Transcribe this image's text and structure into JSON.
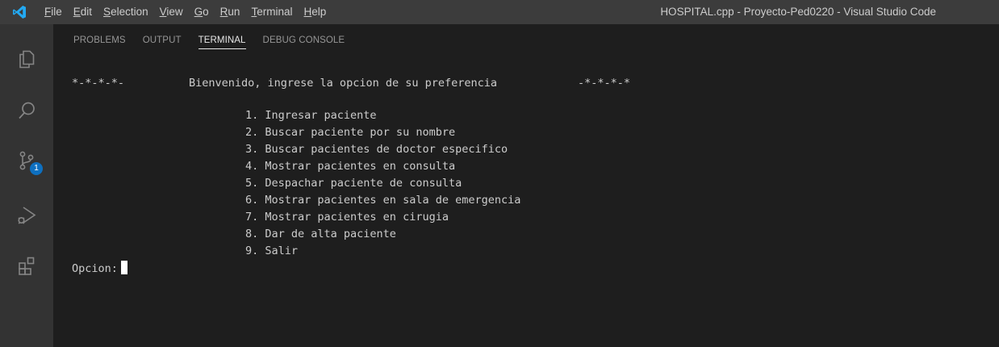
{
  "titlebar": {
    "menu": [
      {
        "mnemonic": "F",
        "rest": "ile"
      },
      {
        "mnemonic": "E",
        "rest": "dit"
      },
      {
        "mnemonic": "S",
        "rest": "election"
      },
      {
        "mnemonic": "V",
        "rest": "iew"
      },
      {
        "mnemonic": "G",
        "rest": "o"
      },
      {
        "mnemonic": "R",
        "rest": "un"
      },
      {
        "mnemonic": "T",
        "rest": "erminal"
      },
      {
        "mnemonic": "H",
        "rest": "elp"
      }
    ],
    "window_title": "HOSPITAL.cpp - Proyecto-Ped0220 - Visual Studio Code"
  },
  "activity_bar": {
    "icons": [
      "explorer-icon",
      "search-icon",
      "source-control-icon",
      "run-debug-icon",
      "extensions-icon"
    ],
    "source_control_badge": "1"
  },
  "panel": {
    "tabs": [
      "PROBLEMS",
      "OUTPUT",
      "TERMINAL",
      "DEBUG CONSOLE"
    ],
    "active_tab": "TERMINAL"
  },
  "terminal": {
    "header_left": "*-*-*-*-",
    "header_text": "Bienvenido, ingrese la opcion de su preferencia",
    "header_right": "-*-*-*-*",
    "options": [
      "1. Ingresar paciente",
      "2. Buscar paciente por su nombre",
      "3. Buscar pacientes de doctor especifico",
      "4. Mostrar pacientes en consulta",
      "5. Despachar paciente de consulta",
      "6. Mostrar pacientes en sala de emergencia",
      "7. Mostrar pacientes en cirugia",
      "8. Dar de alta paciente",
      "9. Salir"
    ],
    "prompt": "Opcion:"
  },
  "colors": {
    "titlebar_bg": "#3c3c3c",
    "activity_bar_bg": "#333333",
    "panel_bg": "#1e1e1e",
    "accent_blue": "#0e70c0"
  }
}
